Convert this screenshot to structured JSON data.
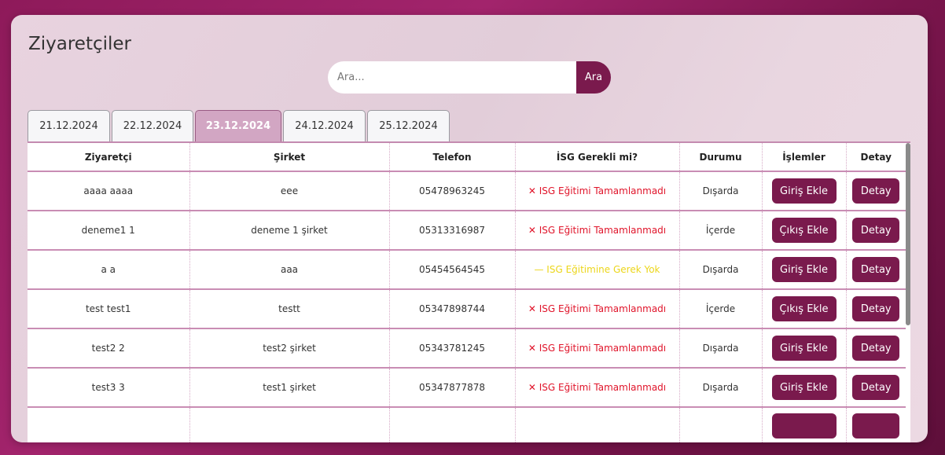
{
  "page": {
    "title": "Ziyaretçiler"
  },
  "search": {
    "placeholder": "Ara...",
    "button_label": "Ara"
  },
  "tabs": [
    {
      "label": "21.12.2024",
      "active": false
    },
    {
      "label": "22.12.2024",
      "active": false
    },
    {
      "label": "23.12.2024",
      "active": true
    },
    {
      "label": "24.12.2024",
      "active": false
    },
    {
      "label": "25.12.2024",
      "active": false
    }
  ],
  "table": {
    "headers": [
      "Ziyaretçi",
      "Şirket",
      "Telefon",
      "İSG Gerekli mi?",
      "Durumu",
      "İşlemler",
      "Detay"
    ],
    "rows": [
      {
        "visitor": "aaaa aaaa",
        "company": "eee",
        "phone": "05478963245",
        "isg": "✕ ISG Eğitimi Tamamlanmadı",
        "isg_status": "red",
        "status": "Dışarda",
        "action": "Giriş Ekle",
        "detail": "Detay"
      },
      {
        "visitor": "deneme1 1",
        "company": "deneme 1 şirket",
        "phone": "05313316987",
        "isg": "✕ ISG Eğitimi Tamamlanmadı",
        "isg_status": "red",
        "status": "İçerde",
        "action": "Çıkış Ekle",
        "detail": "Detay"
      },
      {
        "visitor": "a a",
        "company": "aaa",
        "phone": "05454564545",
        "isg": "— ISG Eğitimine Gerek Yok",
        "isg_status": "yellow",
        "status": "Dışarda",
        "action": "Giriş Ekle",
        "detail": "Detay"
      },
      {
        "visitor": "test test1",
        "company": "testt",
        "phone": "05347898744",
        "isg": "✕ ISG Eğitimi Tamamlanmadı",
        "isg_status": "red",
        "status": "İçerde",
        "action": "Çıkış Ekle",
        "detail": "Detay"
      },
      {
        "visitor": "test2 2",
        "company": "test2 şirket",
        "phone": "05343781245",
        "isg": "✕ ISG Eğitimi Tamamlanmadı",
        "isg_status": "red",
        "status": "Dışarda",
        "action": "Giriş Ekle",
        "detail": "Detay"
      },
      {
        "visitor": "test3 3",
        "company": "test1 şirket",
        "phone": "05347877878",
        "isg": "✕ ISG Eğitimi Tamamlanmadı",
        "isg_status": "red",
        "status": "Dışarda",
        "action": "Giriş Ekle",
        "detail": "Detay"
      }
    ]
  },
  "colors": {
    "accent": "#7a1a4d",
    "active_tab": "#d2a6c3",
    "error": "#e0142a",
    "warning": "#ecd61a"
  }
}
